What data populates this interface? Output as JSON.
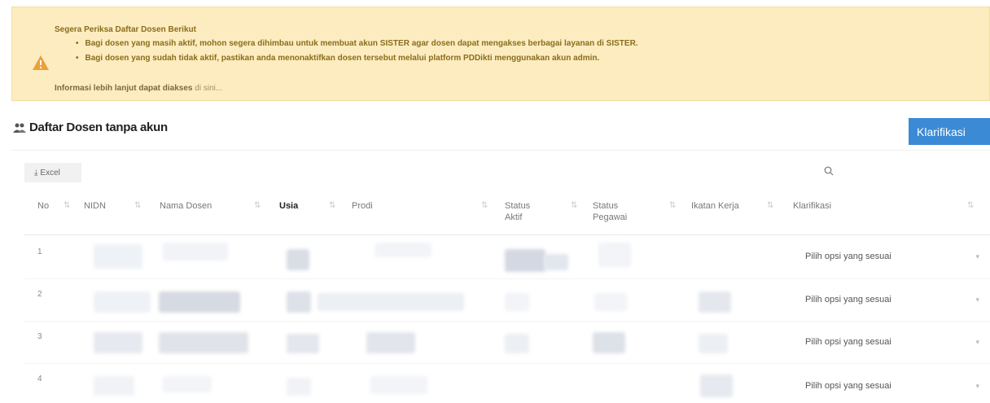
{
  "alert": {
    "title": "Segera Periksa Daftar Dosen Berikut",
    "items": [
      "Bagi dosen yang masih aktif, mohon segera dihimbau untuk membuat akun SISTER agar dosen dapat mengakses berbagai layanan di SISTER.",
      "Bagi dosen yang sudah tidak aktif, pastikan anda menonaktifkan dosen tersebut melalui platform PDDikti menggunakan akun admin."
    ],
    "more_text": "Informasi lebih lanjut dapat diakses",
    "more_link": "di sini...",
    "accent": "#fcecc0",
    "icon": "warning-icon"
  },
  "card": {
    "title": "Daftar Dosen tanpa akun",
    "icon": "users-icon",
    "klarifikasi_button": "Klarifikasi",
    "button_color": "#3a8ad6"
  },
  "toolbar": {
    "excel_label": "Excel",
    "search_icon": "search-icon"
  },
  "table": {
    "columns": [
      {
        "label": "No"
      },
      {
        "label": "NIDN"
      },
      {
        "label": "Nama Dosen"
      },
      {
        "label": "Usia"
      },
      {
        "label": "Prodi"
      },
      {
        "label": "Status Aktif"
      },
      {
        "label": "Status Pegawai"
      },
      {
        "label": "Ikatan Kerja"
      },
      {
        "label": "Klarifikasi"
      }
    ],
    "rows": [
      {
        "no": "1",
        "klarifikasi": "Pilih opsi yang sesuai"
      },
      {
        "no": "2",
        "klarifikasi": "Pilih opsi yang sesuai"
      },
      {
        "no": "3",
        "klarifikasi": "Pilih opsi yang sesuai"
      },
      {
        "no": "4",
        "klarifikasi": "Pilih opsi yang sesuai"
      }
    ]
  }
}
